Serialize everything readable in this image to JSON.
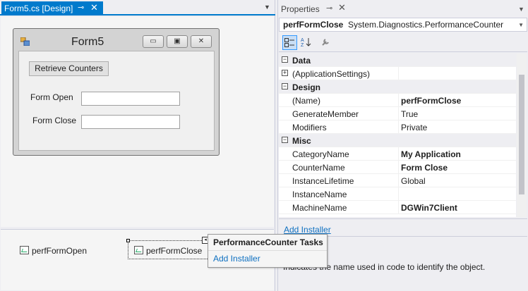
{
  "designer": {
    "tab_label": "Form5.cs [Design]",
    "pin_glyph": "⊸",
    "close_glyph": "✕",
    "form": {
      "title": "Form5",
      "retrieve_button": "Retrieve Counters",
      "label_open": "Form Open",
      "label_close": "Form Close",
      "open_value": "",
      "close_value": ""
    },
    "tray": {
      "items": [
        "perfFormOpen",
        "perfFormClose"
      ]
    },
    "smart_tag": {
      "title": "PerformanceCounter Tasks",
      "link": "Add Installer"
    }
  },
  "properties": {
    "title": "Properties",
    "selected_object": "perfFormClose",
    "selected_type": "System.Diagnostics.PerformanceCounter",
    "categories": [
      {
        "name": "Data",
        "expanded": true,
        "rows": [
          {
            "name": "(ApplicationSettings)",
            "value": "",
            "bold": false,
            "expandable": true
          }
        ]
      },
      {
        "name": "Design",
        "expanded": true,
        "rows": [
          {
            "name": "(Name)",
            "value": "perfFormClose",
            "bold": true
          },
          {
            "name": "GenerateMember",
            "value": "True",
            "bold": false
          },
          {
            "name": "Modifiers",
            "value": "Private",
            "bold": false
          }
        ]
      },
      {
        "name": "Misc",
        "expanded": true,
        "rows": [
          {
            "name": "CategoryName",
            "value": "My Application",
            "bold": true
          },
          {
            "name": "CounterName",
            "value": "Form Close",
            "bold": true
          },
          {
            "name": "InstanceLifetime",
            "value": "Global",
            "bold": false
          },
          {
            "name": "InstanceName",
            "value": "",
            "bold": false
          },
          {
            "name": "MachineName",
            "value": "DGWin7Client",
            "bold": true
          }
        ]
      }
    ],
    "command_link": "Add Installer",
    "description": "Indicates the name used in code to identify the object."
  },
  "colors": {
    "accent": "#007acc",
    "link": "#0e70c0"
  }
}
